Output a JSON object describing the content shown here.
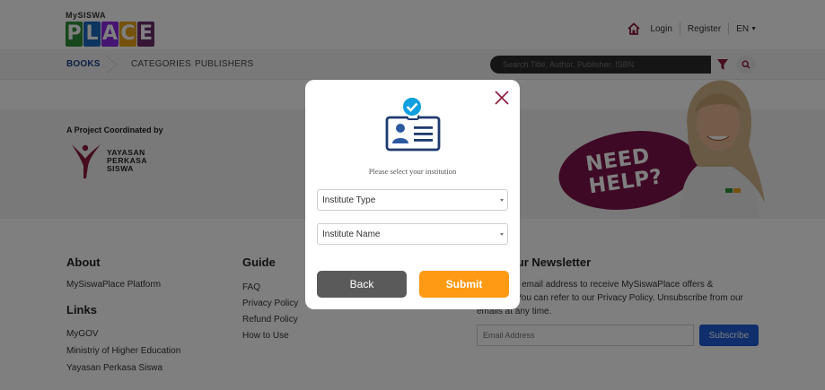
{
  "header": {
    "logo_small_my": "My",
    "logo_small_siswa": "SISWA",
    "logo_letters": [
      "P",
      "L",
      "A",
      "C",
      "E"
    ],
    "logo_colors": [
      "#2f8f3b",
      "#1b6bbf",
      "#8a2be2",
      "#e8a21a",
      "#6b2c6b"
    ],
    "login": "Login",
    "register": "Register",
    "language": "EN",
    "home_icon": "home-icon"
  },
  "nav": {
    "books": "BOOKS",
    "categories": "CATEGORIES",
    "publishers": "PUBLISHERS",
    "search_placeholder": "Search Title, Author, Publisher, ISBN"
  },
  "band": {
    "coordinated_by": "A Project Coordinated by",
    "ypsw_line1": "YAYASAN",
    "ypsw_line2": "PERKASA",
    "ypsw_line3": "SISWA",
    "help_line1": "NEED",
    "help_line2": "HELP?"
  },
  "footer": {
    "about_heading": "About",
    "about_link": "MySiswaPlace Platform",
    "links_heading": "Links",
    "links": [
      "MyGOV",
      "Ministriy of Higher Education",
      "Yayasan Perkasa Siswa"
    ],
    "guide_heading": "Guide",
    "guide_links": [
      "FAQ",
      "Privacy Policy",
      "Refund Policy",
      "How to Use"
    ],
    "newsletter_heading": "be to Our Newsletter",
    "newsletter_line1": "r email address to receive MySiswaPlace offers &",
    "newsletter_line2": "You can refer to our Privacy Policy. Unsubscribe from our",
    "newsletter_line3": "emails at any time.",
    "email_placeholder": "Email Address",
    "subscribe": "Subscribe"
  },
  "modal": {
    "prompt": "Please select your institution",
    "institute_type": "Institute Type",
    "institute_name": "Institute Name",
    "back": "Back",
    "submit": "Submit",
    "accent_color": "#ff9a14",
    "icon": "id-card-check-icon"
  }
}
